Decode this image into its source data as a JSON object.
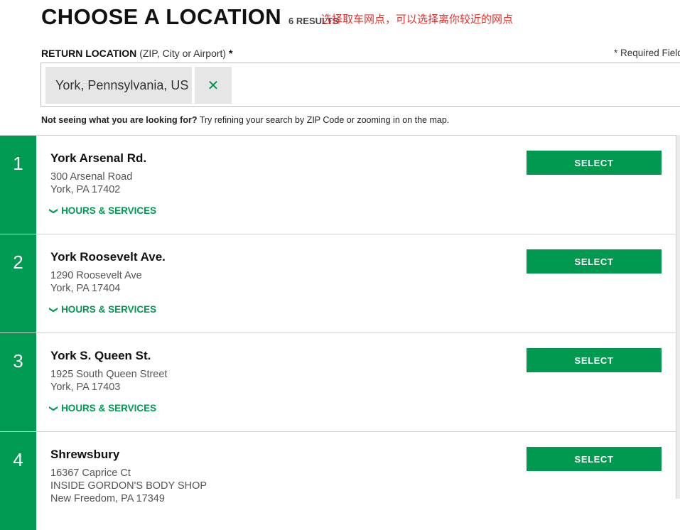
{
  "header": {
    "title": "CHOOSE A LOCATION",
    "results": "6 RESULTS"
  },
  "annotation": "选择取车网点，可以选择离你较近的网点",
  "return_location": {
    "label": "RETURN LOCATION",
    "hint": "(ZIP, City or Airport)",
    "required_mark": "*",
    "required_note": "* Required Field",
    "value": "York, Pennsylvania, US",
    "clear_icon": "close-icon"
  },
  "refine": {
    "bold": "Not seeing what you are looking for?",
    "text": " Try refining your search by ZIP Code or zooming in on the map."
  },
  "colors": {
    "brand_green": "#009b52",
    "annotation_red": "#e0322d"
  },
  "locations": [
    {
      "num": "1",
      "name": "York Arsenal Rd.",
      "line1": "300 Arsenal Road",
      "line2": "York, PA 17402",
      "line3": "",
      "hours": "HOURS & SERVICES",
      "select": "SELECT"
    },
    {
      "num": "2",
      "name": "York Roosevelt Ave.",
      "line1": "1290 Roosevelt Ave",
      "line2": "York, PA 17404",
      "line3": "",
      "hours": "HOURS & SERVICES",
      "select": "SELECT"
    },
    {
      "num": "3",
      "name": "York S. Queen St.",
      "line1": "1925 South Queen Street",
      "line2": "York, PA 17403",
      "line3": "",
      "hours": "HOURS & SERVICES",
      "select": "SELECT"
    },
    {
      "num": "4",
      "name": "Shrewsbury",
      "line1": "16367 Caprice Ct",
      "line2": "INSIDE GORDON'S BODY SHOP",
      "line3": "New Freedom, PA 17349",
      "hours": "",
      "select": "SELECT"
    }
  ]
}
